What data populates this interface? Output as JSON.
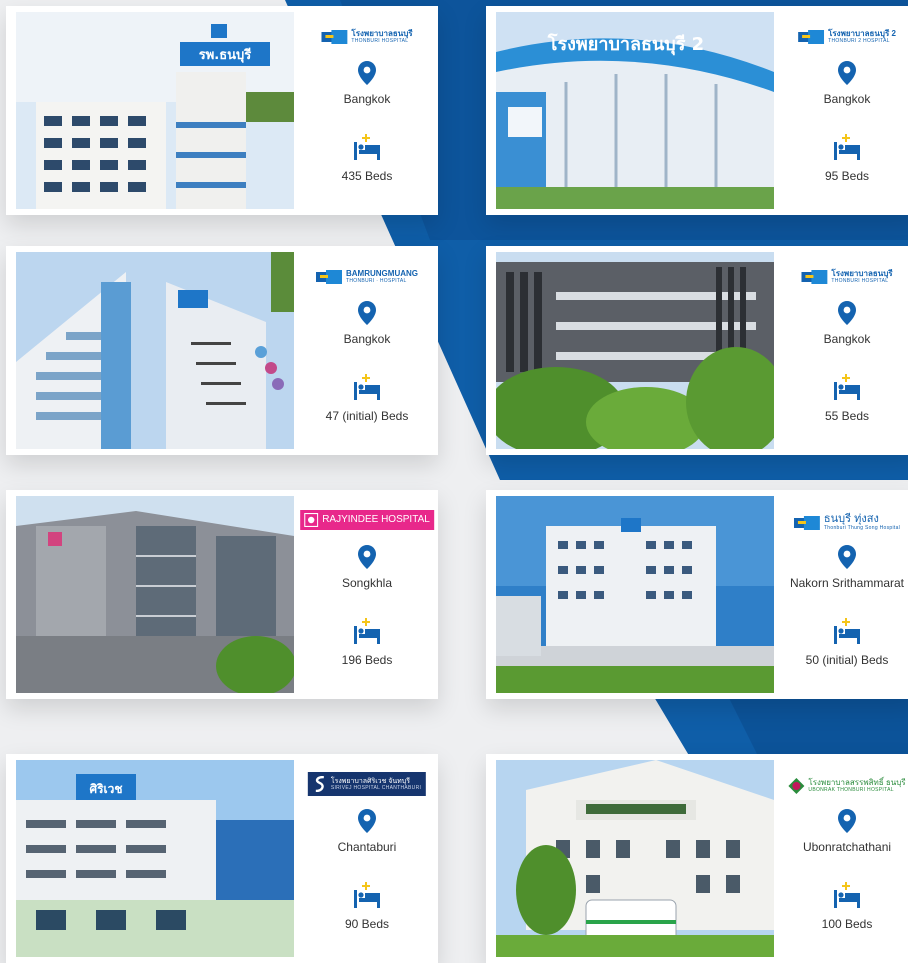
{
  "colors": {
    "brand_blue": "#1463b0",
    "background": "#eeeff1",
    "accent_yellow": "#f5c518",
    "rajyindee_pink": "#e8288b",
    "siriwej_navy": "#16356e",
    "sappasit_green": "#2a8c3c"
  },
  "icons": {
    "location": "map-pin-icon",
    "beds": "bed-icon"
  },
  "hospitals": [
    {
      "logo_th": "โรงพยาบาลธนบุรี",
      "logo_en": "THONBURI HOSPITAL",
      "photo_sign": "รพ.ธนบุรี",
      "location": "Bangkok",
      "beds": "435 Beds"
    },
    {
      "logo_th": "โรงพยาบาลธนบุรี 2",
      "logo_en": "THONBURI 2 HOSPITAL",
      "photo_sign": "โรงพยาบาลธนบุรี 2",
      "location": "Bangkok",
      "beds": "95 Beds"
    },
    {
      "logo_th": "BAMRUNGMUANG",
      "logo_en": "THONBURI · HOSPITAL",
      "location": "Bangkok",
      "beds": "47 (initial) Beds"
    },
    {
      "logo_th": "โรงพยาบาลธนบุรี",
      "logo_en": "THONBURI HOSPITAL",
      "location": "Bangkok",
      "beds": "55 Beds"
    },
    {
      "logo_th": "RAJYINDEE HOSPITAL",
      "location": "Songkhla",
      "beds": "196 Beds"
    },
    {
      "logo_th": "ธนบุรี ทุ่งสง",
      "logo_en": "Thonburi Thung Song Hospital",
      "location": "Nakorn Srithammarat",
      "beds": "50 (initial) Beds"
    },
    {
      "logo_th": "โรงพยาบาลศิริเวช จันทบุรี",
      "logo_en": "SIRIVEJ HOSPITAL CHANTHABURI",
      "photo_sign": "ศิริเวช",
      "location": "Chantaburi",
      "beds": "90 Beds"
    },
    {
      "logo_th": "โรงพยาบาลสรรพสิทธิ์ ธนบุรี",
      "logo_en": "UBONRAK THONBURI HOSPITAL",
      "location": "Ubonratchathani",
      "beds": "100 Beds"
    }
  ]
}
